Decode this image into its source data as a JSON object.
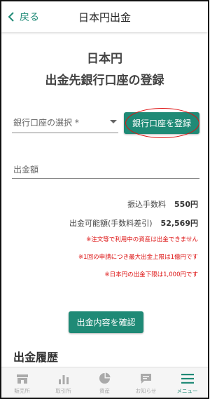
{
  "header": {
    "back_label": "戻る",
    "title": "日本円出金"
  },
  "page": {
    "title_line1": "日本円",
    "title_line2": "出金先銀行口座の登録"
  },
  "form": {
    "bank_select_label": "銀行口座の選択 *",
    "register_button": "銀行口座を登録",
    "amount_label": "出金額"
  },
  "fees": {
    "transfer_fee_label": "振込手数料",
    "transfer_fee_value": "550円",
    "available_label": "出金可能額(手数料差引)",
    "available_value": "52,569円"
  },
  "notes": [
    "※注文等で利用中の資産は出金できません",
    "※1回の申請につき最大出金上限は1億円です",
    "※日本円の出金下限は1,000円です"
  ],
  "confirm_button": "出金内容を確認",
  "history_title": "出金履歴",
  "tabbar": {
    "items": [
      {
        "label": "販売所",
        "icon": "store-icon"
      },
      {
        "label": "取引所",
        "icon": "bar-chart-icon"
      },
      {
        "label": "資産",
        "icon": "pie-chart-icon"
      },
      {
        "label": "お知らせ",
        "icon": "message-icon"
      },
      {
        "label": "メニュー",
        "icon": "menu-icon"
      }
    ],
    "active_index": 4
  },
  "colors": {
    "accent": "#1f8a76",
    "warning": "#dd1111",
    "inactive": "#aaaaaa"
  }
}
